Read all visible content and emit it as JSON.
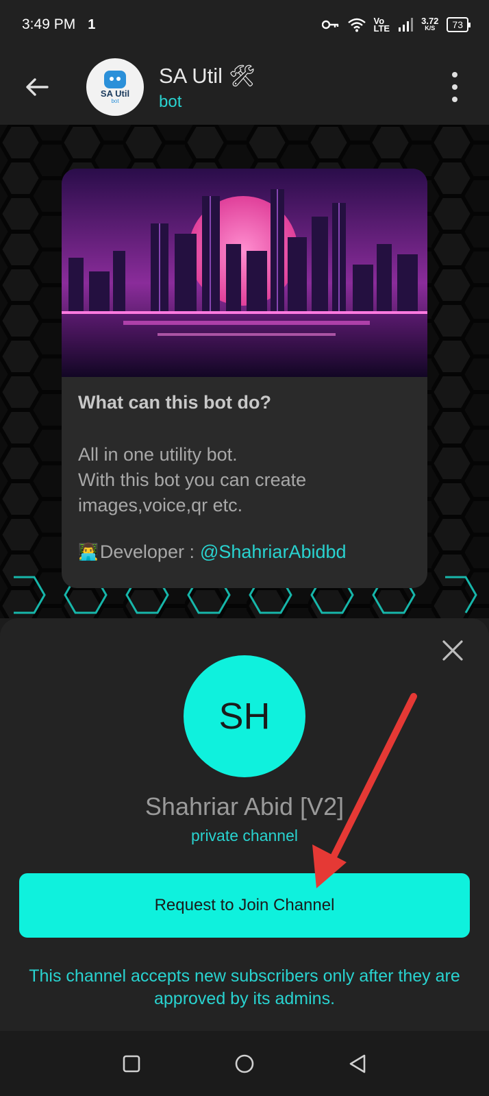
{
  "status_bar": {
    "time": "3:49 PM",
    "network_indicator": "1",
    "network_label_top": "Vo",
    "network_label_bottom": "LTE",
    "speed_value": "3.72",
    "speed_unit": "K/S",
    "battery": "73"
  },
  "header": {
    "title": "SA Util 🛠",
    "subtitle": "bot",
    "avatar_text": "SA Util",
    "avatar_subtext": "bot"
  },
  "message": {
    "heading": "What can this bot do?",
    "body_lines": [
      "All in one utility bot.",
      "With this bot you can create",
      "images,voice,qr etc."
    ],
    "developer_emoji": "👨‍💻",
    "developer_label": "Developer :",
    "developer_handle": "@ShahriarAbidbd"
  },
  "sheet": {
    "avatar_initials": "SH",
    "channel_name": "Shahriar Abid [V2]",
    "channel_type": "private channel",
    "join_button": "Request to Join Channel",
    "note": "This channel accepts new subscribers only after they are approved by its admins."
  },
  "colors": {
    "accent": "#0ff1dd",
    "link": "#29d3d0",
    "annotation": "#e53935"
  },
  "icons": {
    "back": "arrow-left-icon",
    "menu": "more-vertical-icon",
    "close": "close-icon",
    "nav_recent": "square-icon",
    "nav_home": "circle-icon",
    "nav_back": "triangle-back-icon"
  }
}
